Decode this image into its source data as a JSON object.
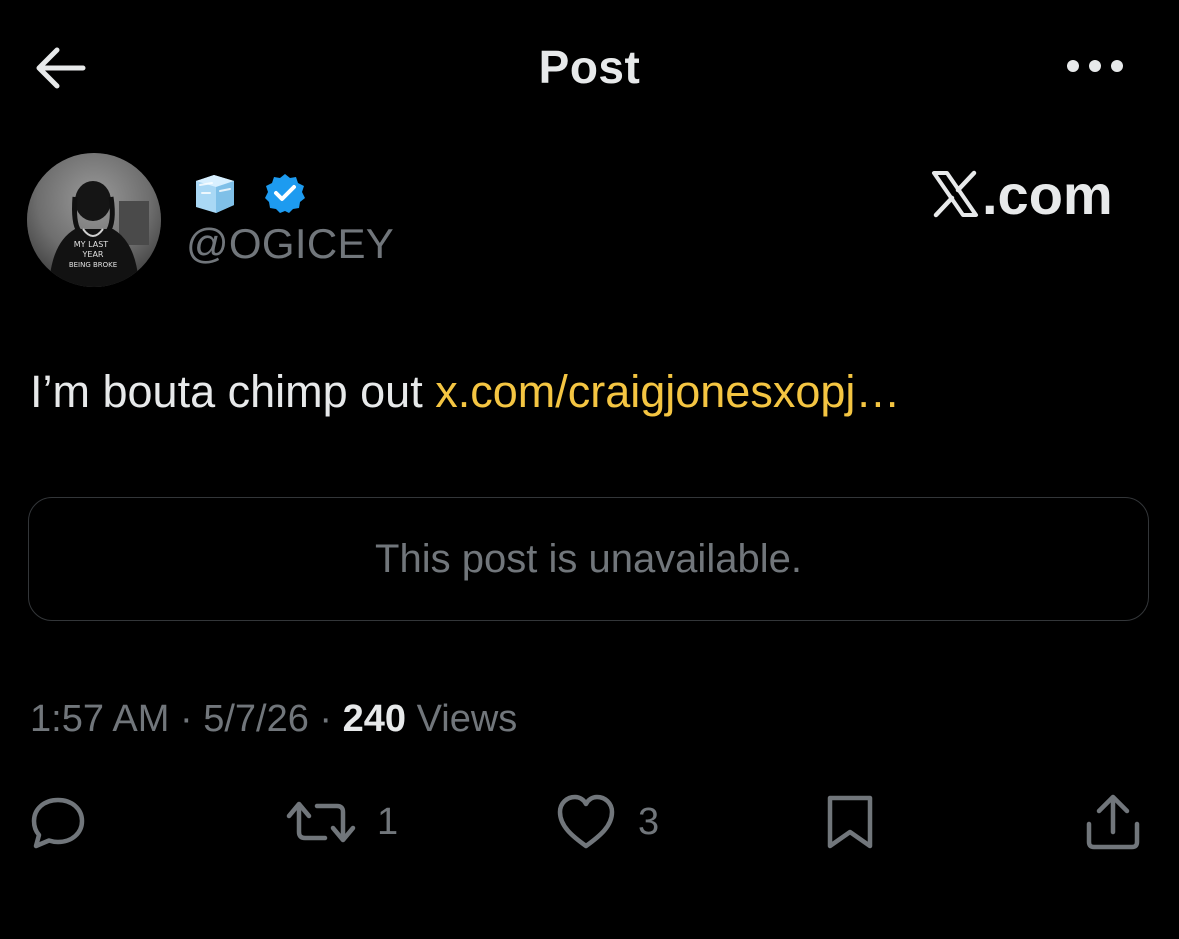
{
  "header": {
    "title": "Post",
    "back_icon": "arrow-left-icon",
    "more_icon": "more-horizontal-icon"
  },
  "author": {
    "display_name_emoji": "🧊",
    "handle": "@OGICEY",
    "verified": true,
    "verified_color": "#1d9bf0",
    "avatar_shirt_text": [
      "MY LAST",
      "YEAR",
      "BEING BROKE"
    ]
  },
  "watermark": {
    "text": ".com"
  },
  "post": {
    "text": "I’m bouta chimp out ",
    "link": "x.com/craigjonesxopj…",
    "link_color": "#f4c542"
  },
  "quoted": {
    "text": "This post is unavailable."
  },
  "meta": {
    "time": "1:57 AM",
    "separator": " · ",
    "date": "5/7/26",
    "views_count": "240",
    "views_label": " Views"
  },
  "actions": {
    "reply": {
      "icon": "reply-icon",
      "count": ""
    },
    "repost": {
      "icon": "repost-icon",
      "count": "1"
    },
    "like": {
      "icon": "heart-icon",
      "count": "3"
    },
    "bookmark": {
      "icon": "bookmark-icon",
      "count": ""
    },
    "share": {
      "icon": "share-icon",
      "count": ""
    }
  },
  "colors": {
    "background": "#000000",
    "primary_text": "#e7e9ea",
    "secondary_text": "#71767b",
    "border": "#333639"
  }
}
